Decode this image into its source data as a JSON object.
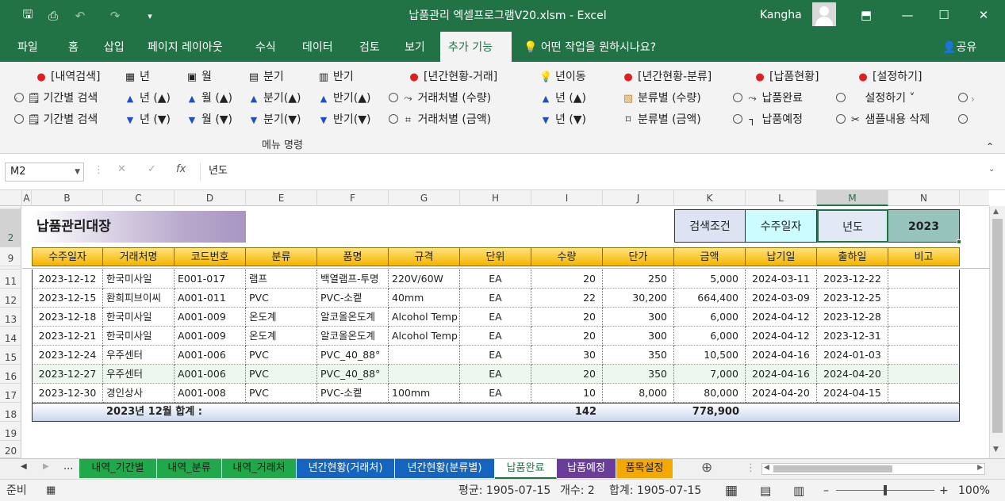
{
  "app": {
    "title": "납품관리 엑셀프로그램V20.xlsm  -  Excel",
    "user": "Kangha"
  },
  "ribbon_tabs": [
    "파일",
    "홈",
    "삽입",
    "페이지 레이아웃",
    "수식",
    "데이터",
    "검토",
    "보기",
    "추가 기능"
  ],
  "tell_me": "어떤 작업을 원하시나요?",
  "share": "공유",
  "ribbon": {
    "col1": [
      "[내역검색]",
      "기간별 검색",
      "기간별 검색"
    ],
    "col2": [
      "년",
      "년 (▲)",
      "년 (▼)"
    ],
    "col3": [
      "월",
      "월 (▲)",
      "월 (▼)"
    ],
    "col4": [
      "분기",
      "분기(▲)",
      "분기(▼)"
    ],
    "col5": [
      "반기",
      "반기(▲)",
      "반기(▼)"
    ],
    "col6": [
      "[년간현황-거래]",
      "거래처별 (수량)",
      "거래처별 (금액)"
    ],
    "col7": [
      "년이동",
      "년 (▲)",
      "년 (▼)"
    ],
    "col8": [
      "[년간현황-분류]",
      "분류별 (수량)",
      "분류별 (금액)"
    ],
    "col9": [
      "[납품현황]",
      "납품완료",
      "납품예정"
    ],
    "col10": [
      "[설정하기]",
      "설정하기 ˅",
      "샘플내용 삭제"
    ],
    "group_label": "메뉴 명령"
  },
  "formula": {
    "name_box": "M2",
    "value": "년도"
  },
  "columns": [
    "A",
    "B",
    "C",
    "D",
    "E",
    "F",
    "G",
    "H",
    "I",
    "J",
    "K",
    "L",
    "M",
    "N"
  ],
  "rows": [
    "1",
    "2",
    "9",
    "10",
    "11",
    "12",
    "13",
    "14",
    "15",
    "16",
    "17",
    "18",
    "19",
    "20"
  ],
  "sheet": {
    "title": "납품관리대장",
    "search_label": "검색조건",
    "search_field": "수주일자",
    "year_label": "년도",
    "year_value": "2023",
    "headers": [
      "수주일자",
      "거래처명",
      "코드번호",
      "분류",
      "품명",
      "규격",
      "단위",
      "수량",
      "단가",
      "금액",
      "납기일",
      "출하일",
      "비고"
    ],
    "data": [
      [
        "2023-12-12",
        "한국미사일",
        "E001-017",
        "램프",
        "백열램프-투명",
        "220V/60W",
        "EA",
        "20",
        "250",
        "5,000",
        "2024-03-11",
        "2023-12-22",
        ""
      ],
      [
        "2023-12-15",
        "환희피브이씨",
        "A001-011",
        "PVC",
        "PVC-소켙",
        "40mm",
        "EA",
        "22",
        "30,200",
        "664,400",
        "2024-03-09",
        "2023-12-25",
        ""
      ],
      [
        "2023-12-18",
        "한국미사일",
        "A001-009",
        "온도계",
        "알코올온도계",
        "Alcohol Temp",
        "EA",
        "20",
        "300",
        "6,000",
        "2024-04-12",
        "2023-12-28",
        ""
      ],
      [
        "2023-12-21",
        "한국미사일",
        "A001-009",
        "온도계",
        "알코올온도계",
        "Alcohol Temp",
        "EA",
        "20",
        "300",
        "6,000",
        "2024-04-12",
        "2023-12-31",
        ""
      ],
      [
        "2023-12-24",
        "우주센터",
        "A001-006",
        "PVC",
        "PVC_40_88°",
        "",
        "EA",
        "30",
        "350",
        "10,500",
        "2024-04-16",
        "2024-01-03",
        ""
      ],
      [
        "2023-12-27",
        "우주센터",
        "A001-006",
        "PVC",
        "PVC_40_88°",
        "",
        "EA",
        "20",
        "350",
        "7,000",
        "2024-04-16",
        "2024-04-20",
        ""
      ],
      [
        "2023-12-30",
        "경인상사",
        "A001-008",
        "PVC",
        "PVC-소켙",
        "100mm",
        "EA",
        "10",
        "8,000",
        "80,000",
        "2024-04-20",
        "2024-04-15",
        ""
      ]
    ],
    "total_label": "2023년 12월 합계  :",
    "total_qty": "142",
    "total_amount": "778,900"
  },
  "sheet_tabs": [
    {
      "label": "내역_기간별",
      "color": "#21a84a",
      "text": "#1a1a1a"
    },
    {
      "label": "내역_분류",
      "color": "#21a84a",
      "text": "#1a1a1a"
    },
    {
      "label": "내역_거래처",
      "color": "#21a84a",
      "text": "#1a1a1a"
    },
    {
      "label": "년간현황(거래처)",
      "color": "#1565c0",
      "text": "#ffffff"
    },
    {
      "label": "년간현황(분류별)",
      "color": "#1565c0",
      "text": "#ffffff"
    },
    {
      "label": "납품완료",
      "color": "#ffffff",
      "text": "#217346"
    },
    {
      "label": "납품예정",
      "color": "#6a3d9a",
      "text": "#ffffff"
    },
    {
      "label": "품목설정",
      "color": "#f5a800",
      "text": "#1a1a1a"
    }
  ],
  "status": {
    "ready": "준비",
    "average": "평균: 1905-07-15",
    "count": "개수: 2",
    "sum": "합계: 1905-07-15",
    "zoom": "100%"
  }
}
